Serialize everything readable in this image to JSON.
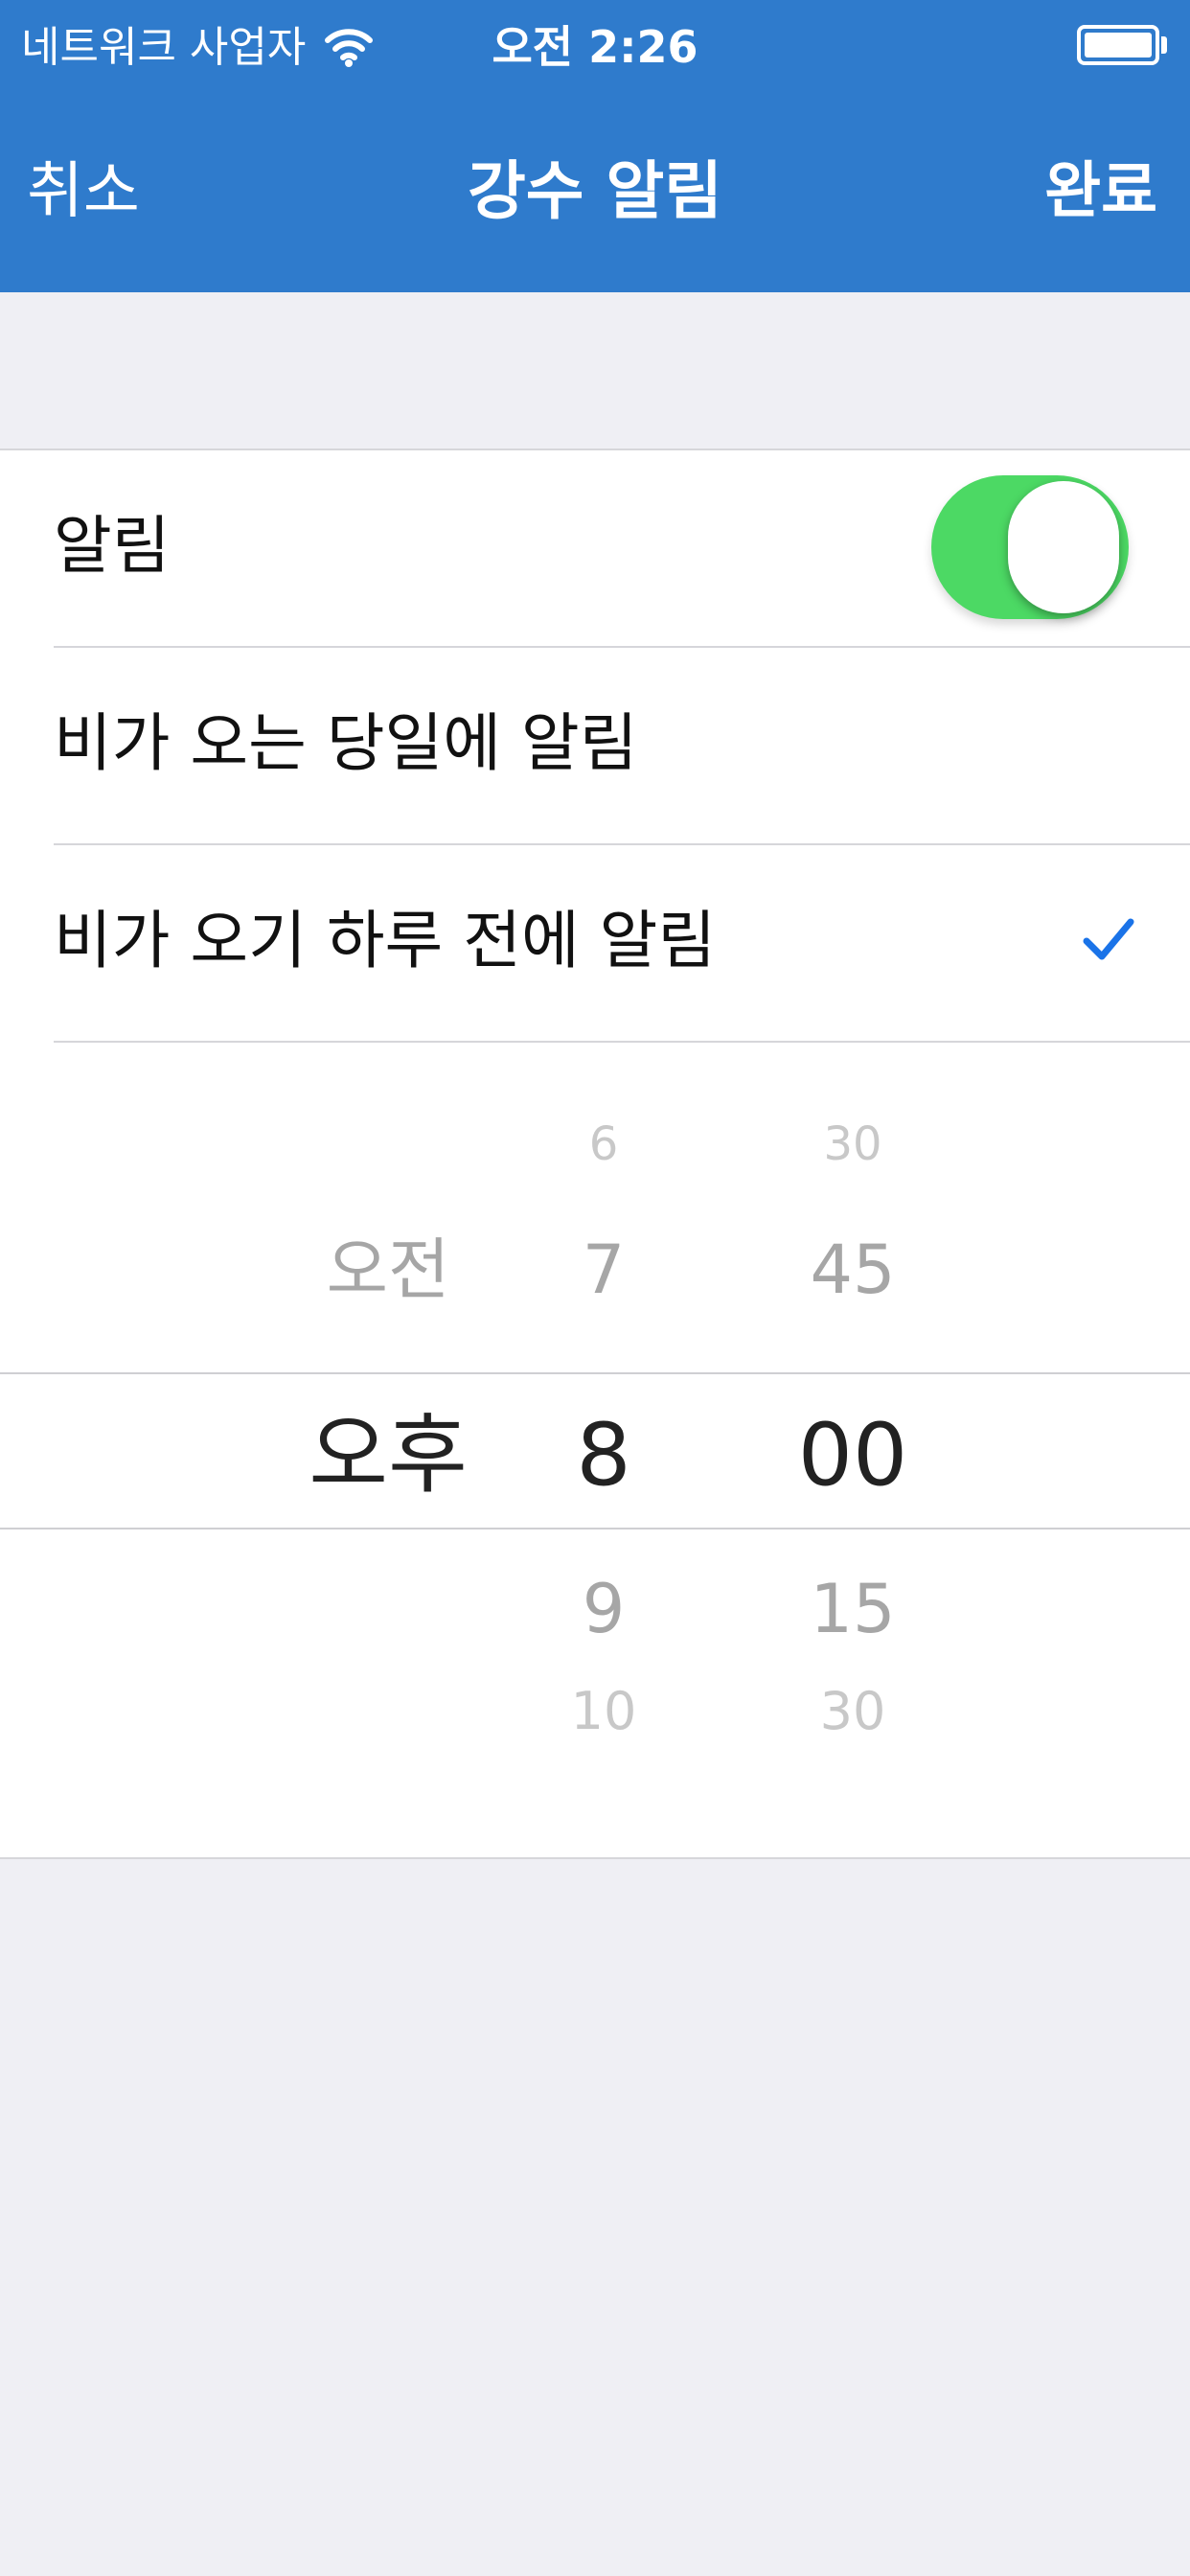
{
  "status_bar": {
    "carrier": "네트워크 사업자",
    "time": "오전 2:26"
  },
  "nav": {
    "cancel_label": "취소",
    "title": "강수 알림",
    "done_label": "완료"
  },
  "settings": {
    "alarm_label": "알림",
    "alarm_enabled": true,
    "option_same_day": "비가 오는 당일에 알림",
    "option_day_before": "비가 오기 하루 전에 알림",
    "selected_option": "option_day_before"
  },
  "time_picker": {
    "ampm": {
      "above": "오전",
      "selected": "오후"
    },
    "hour": {
      "above2": "6",
      "above1": "7",
      "selected": "8",
      "below1": "9",
      "below2": "10"
    },
    "minute": {
      "above2": "30",
      "above1": "45",
      "selected": "00",
      "below1": "15",
      "below2": "30"
    }
  },
  "colors": {
    "nav_bar": "#2f7bcc",
    "toggle_on": "#4cd964",
    "checkmark": "#1a73e8",
    "background": "#efeff4"
  },
  "icons": {
    "wifi": "wifi-icon",
    "battery": "battery-icon",
    "checkmark": "checkmark-icon"
  }
}
